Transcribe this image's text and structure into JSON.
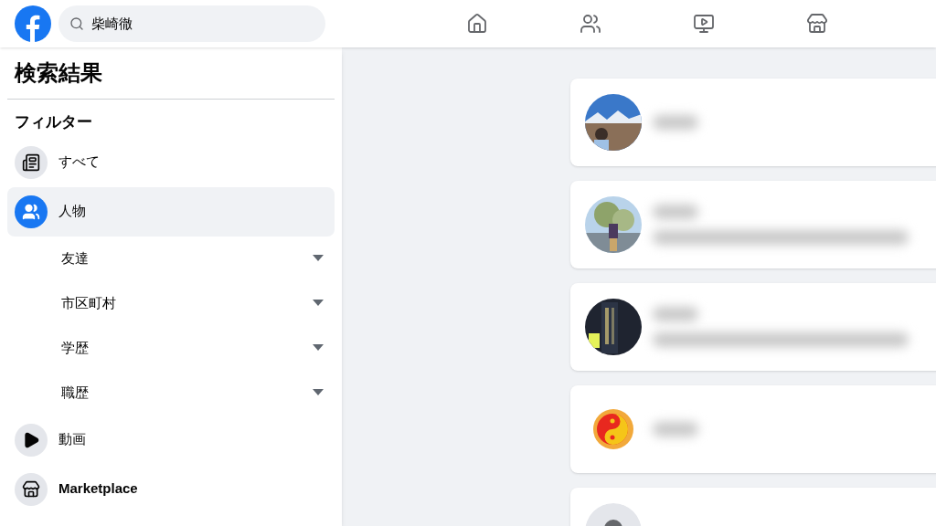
{
  "search": {
    "value": "柴崎徹"
  },
  "nav": [
    {
      "kind": "home"
    },
    {
      "kind": "friends"
    },
    {
      "kind": "video"
    },
    {
      "kind": "marketplace"
    }
  ],
  "sidebar": {
    "title": "検索結果",
    "filter_heading": "フィルター",
    "items": [
      {
        "label": "すべて",
        "kind": "all",
        "selected": false
      },
      {
        "label": "人物",
        "kind": "people",
        "selected": true,
        "children": [
          {
            "label": "友達"
          },
          {
            "label": "市区町村"
          },
          {
            "label": "学歴"
          },
          {
            "label": "職歴"
          }
        ]
      },
      {
        "label": "動画",
        "kind": "video",
        "selected": false
      },
      {
        "label": "Marketplace",
        "kind": "marketplace",
        "selected": false
      }
    ]
  },
  "results": [
    {
      "kind": "picture"
    },
    {
      "kind": "picture"
    },
    {
      "kind": "picture"
    },
    {
      "kind": "picture"
    },
    {
      "kind": "default_avatar"
    }
  ]
}
